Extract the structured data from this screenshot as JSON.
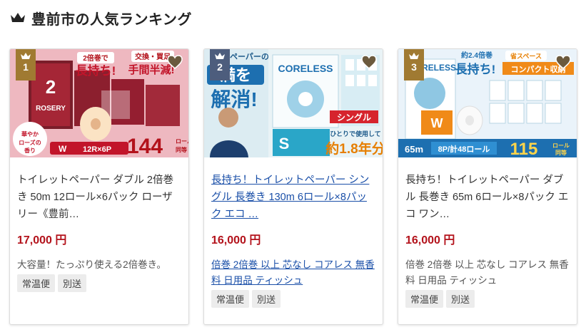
{
  "section": {
    "title": "豊前市の人気ランキング",
    "icon": "crown-icon"
  },
  "colors": {
    "price": "#b3121b",
    "link": "#1a4fa8",
    "rank_gold": "#a07a32",
    "rank_silver": "#4d5d7d"
  },
  "products": [
    {
      "rank": "1",
      "image_text": {
        "badge1": "2倍巻で",
        "badge2": "長持ち!",
        "badge3": "交換・買足",
        "badge4": "手間半減!",
        "brand": "ROSERY",
        "scent": "華やか ローズの 香り",
        "spec_w": "W",
        "spec": "12R×6P",
        "count": "144",
        "count_unit": "ロール 同等"
      },
      "name": "トイレットペーパー ダブル 2倍巻き 50m 12ロール×6パック ローザリー《豊前…",
      "price": "17,000 円",
      "description": "大容量！たっぷり使える2倍巻き。",
      "tags": [
        "常温便",
        "別送"
      ]
    },
    {
      "rank": "2",
      "image_text": {
        "top": "ペーパーの",
        "mid": "満を",
        "big": "解消!",
        "brand": "CORELESS",
        "type": "シングル",
        "note": "ひとりで使用して お届け!",
        "years": "約1.8年分",
        "size": "S"
      },
      "name": "長持ち！トイレットペーパー シングル 長巻き 130m 6ロール×8パック エコ …",
      "price": "16,000 円",
      "description": "倍巻 2倍巻 以上 芯なし コアレス 無香料 日用品 ティッシュ",
      "tags": [
        "常温便",
        "別送"
      ]
    },
    {
      "rank": "3",
      "image_text": {
        "badge1": "約2.4倍巻",
        "badge2": "長持ち!",
        "badge3": "省スペース",
        "badge4": "コンパクト収納",
        "brand": "CORELESS",
        "length": "65m",
        "pack": "8P/計48ロール",
        "count": "115",
        "count_unit": "ロール 同等",
        "size": "W"
      },
      "name": "長持ち！トイレットペーパー ダブル 長巻き 65m 6ロール×8パック エコ ワン…",
      "price": "16,000 円",
      "description": "倍巻 2倍巻 以上 芯なし コアレス 無香料 日用品 ティッシュ",
      "tags": [
        "常温便",
        "別送"
      ]
    }
  ]
}
